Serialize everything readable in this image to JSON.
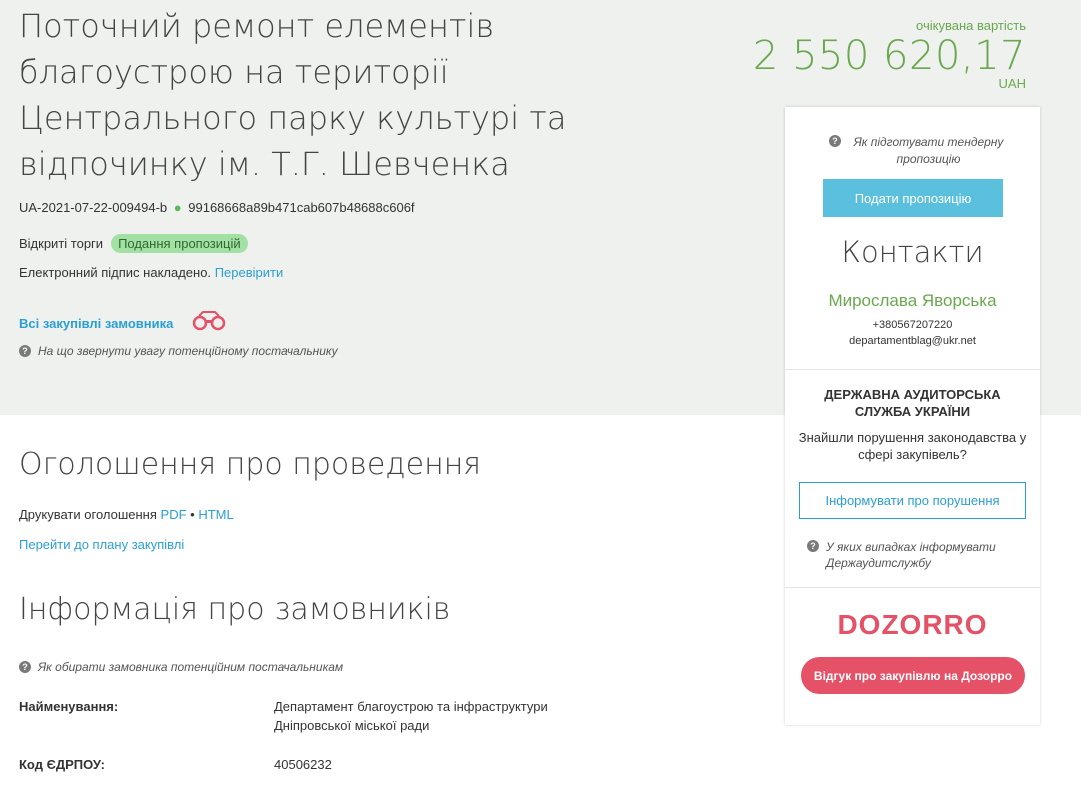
{
  "tender": {
    "title": "Поточний ремонт елементів благоустрою на території Центрального парку культурі та відпочинку ім. Т.Г. Шевченка",
    "id": "UA-2021-07-22-009494-b",
    "hash": "99168668a89b471cab607b48688c606f",
    "procedure": "Відкриті торги",
    "status": "Подання пропозицій",
    "signature_text": "Електронний підпис накладено.",
    "signature_link": "Перевірити",
    "all_purchases_link": "Всі закупівлі замовника",
    "supplier_hint": "На що звернути увагу потенційному постачальнику"
  },
  "expected_value": {
    "label": "очікувана вартість",
    "amount": "2 550 620,17",
    "currency": "UAH"
  },
  "sidebar": {
    "proposal_hint": "Як підготувати тендерну пропозицію",
    "submit_button": "Подати пропозицію",
    "contacts_title": "Контакти",
    "contact_name": "Мирослава Яворська",
    "contact_phone": "+380567207220",
    "contact_email": "departamentblag@ukr.net",
    "audit_title": "ДЕРЖАВНА АУДИТОРСЬКА СЛУЖБА УКРАЇНИ",
    "audit_question": "Знайшли порушення законодавства у сфері закупівель?",
    "report_button": "Інформувати про порушення",
    "audit_hint": "У яких випадках інформувати Держаудитслужбу",
    "dozorro_logo": "DOZORRO",
    "dozorro_button": "Відгук про закупівлю на Дозорро"
  },
  "announcement": {
    "title": "Оголошення про проведення",
    "print_label": "Друкувати оголошення",
    "pdf_link": "PDF",
    "separator": "•",
    "html_link": "HTML",
    "plan_link": "Перейти до плану закупівлі"
  },
  "customers": {
    "title": "Інформація про замовників",
    "hint": "Як обирати замовника потенційним постачальникам",
    "name_label": "Найменування:",
    "name_value": "Департамент благоустрою та інфраструктури Дніпровської міської ради",
    "edrpou_label": "Код ЄДРПОУ:",
    "edrpou_value": "40506232"
  },
  "colors": {
    "accent_green": "#6aa84f",
    "link_blue": "#2a9fd6",
    "button_cyan": "#5bc0de",
    "dozorro_red": "#e55166",
    "status_badge_bg": "#a3e0a3"
  },
  "icons": [
    "question-circle-icon",
    "binoculars-icon"
  ]
}
